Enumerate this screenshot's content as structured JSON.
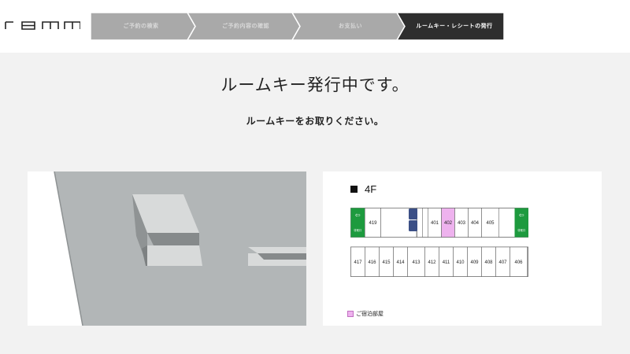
{
  "header": {
    "logo_text": "remm",
    "steps": [
      {
        "label": "ご予約の検索",
        "active": false
      },
      {
        "label": "ご予約内容の確認",
        "active": false
      },
      {
        "label": "お支払い",
        "active": false
      },
      {
        "label": "ルームキー・レシートの発行",
        "active": true
      }
    ]
  },
  "main": {
    "title": "ルームキー発行中です。",
    "subtitle": "ルームキーをお取りください。"
  },
  "floor": {
    "name": "4F",
    "exit_label": "非常口",
    "upper_rooms": [
      "419",
      "401",
      "402",
      "403",
      "404",
      "405"
    ],
    "highlighted_room": "402",
    "lower_rooms": [
      "417",
      "416",
      "415",
      "414",
      "413",
      "412",
      "411",
      "410",
      "409",
      "408",
      "407",
      "406"
    ],
    "legend": "ご宿泊部屋",
    "colors": {
      "highlight": "#eeb2ee",
      "exit": "#1d9a3e",
      "elevator": "#3b4f86"
    }
  }
}
